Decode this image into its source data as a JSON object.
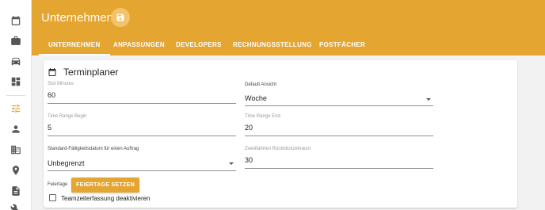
{
  "sidebar": {
    "items": [
      {
        "name": "calendar-icon"
      },
      {
        "name": "briefcase-icon"
      },
      {
        "name": "car-icon"
      },
      {
        "name": "dashboard-icon"
      },
      {
        "name": "tune-icon",
        "active": true
      },
      {
        "name": "person-icon"
      },
      {
        "name": "building-icon"
      },
      {
        "name": "location-icon"
      },
      {
        "name": "document-icon"
      },
      {
        "name": "wrench-icon"
      }
    ]
  },
  "header": {
    "title": "Unternehmen",
    "save_icon": "save-icon",
    "accent_color": "#e5a531"
  },
  "tabs": [
    {
      "label": "UNTERNEHMEN",
      "active": true
    },
    {
      "label": "ANPASSUNGEN"
    },
    {
      "label": "DEVELOPERS"
    },
    {
      "label": "RECHNUNGSSTELLUNG"
    },
    {
      "label": "POSTFÄCHER"
    }
  ],
  "card": {
    "title": "Terminplaner",
    "title_icon": "calendar-icon",
    "fields": {
      "slot_minutes": {
        "label": "Slot Minutes",
        "value": "60"
      },
      "default_view": {
        "label": "Default Ansicht",
        "value": "Woche"
      },
      "time_range_begin": {
        "label": "Time Range Begin",
        "value": "5"
      },
      "time_range_end": {
        "label": "Time Range End",
        "value": "20"
      },
      "due_date": {
        "label": "Standard-Fälligkeitsdatum für einen Auftrag",
        "value": "Unbegrenzt"
      },
      "timespan_back": {
        "label": "Zweitfahrten Rückblickzeitraum",
        "value": "30"
      }
    },
    "holidays_label": "Feiertage",
    "holidays_button": "FEIERTAGE SETZEN",
    "team_time_label": "Teamzeiterfassung deaktivieren"
  }
}
